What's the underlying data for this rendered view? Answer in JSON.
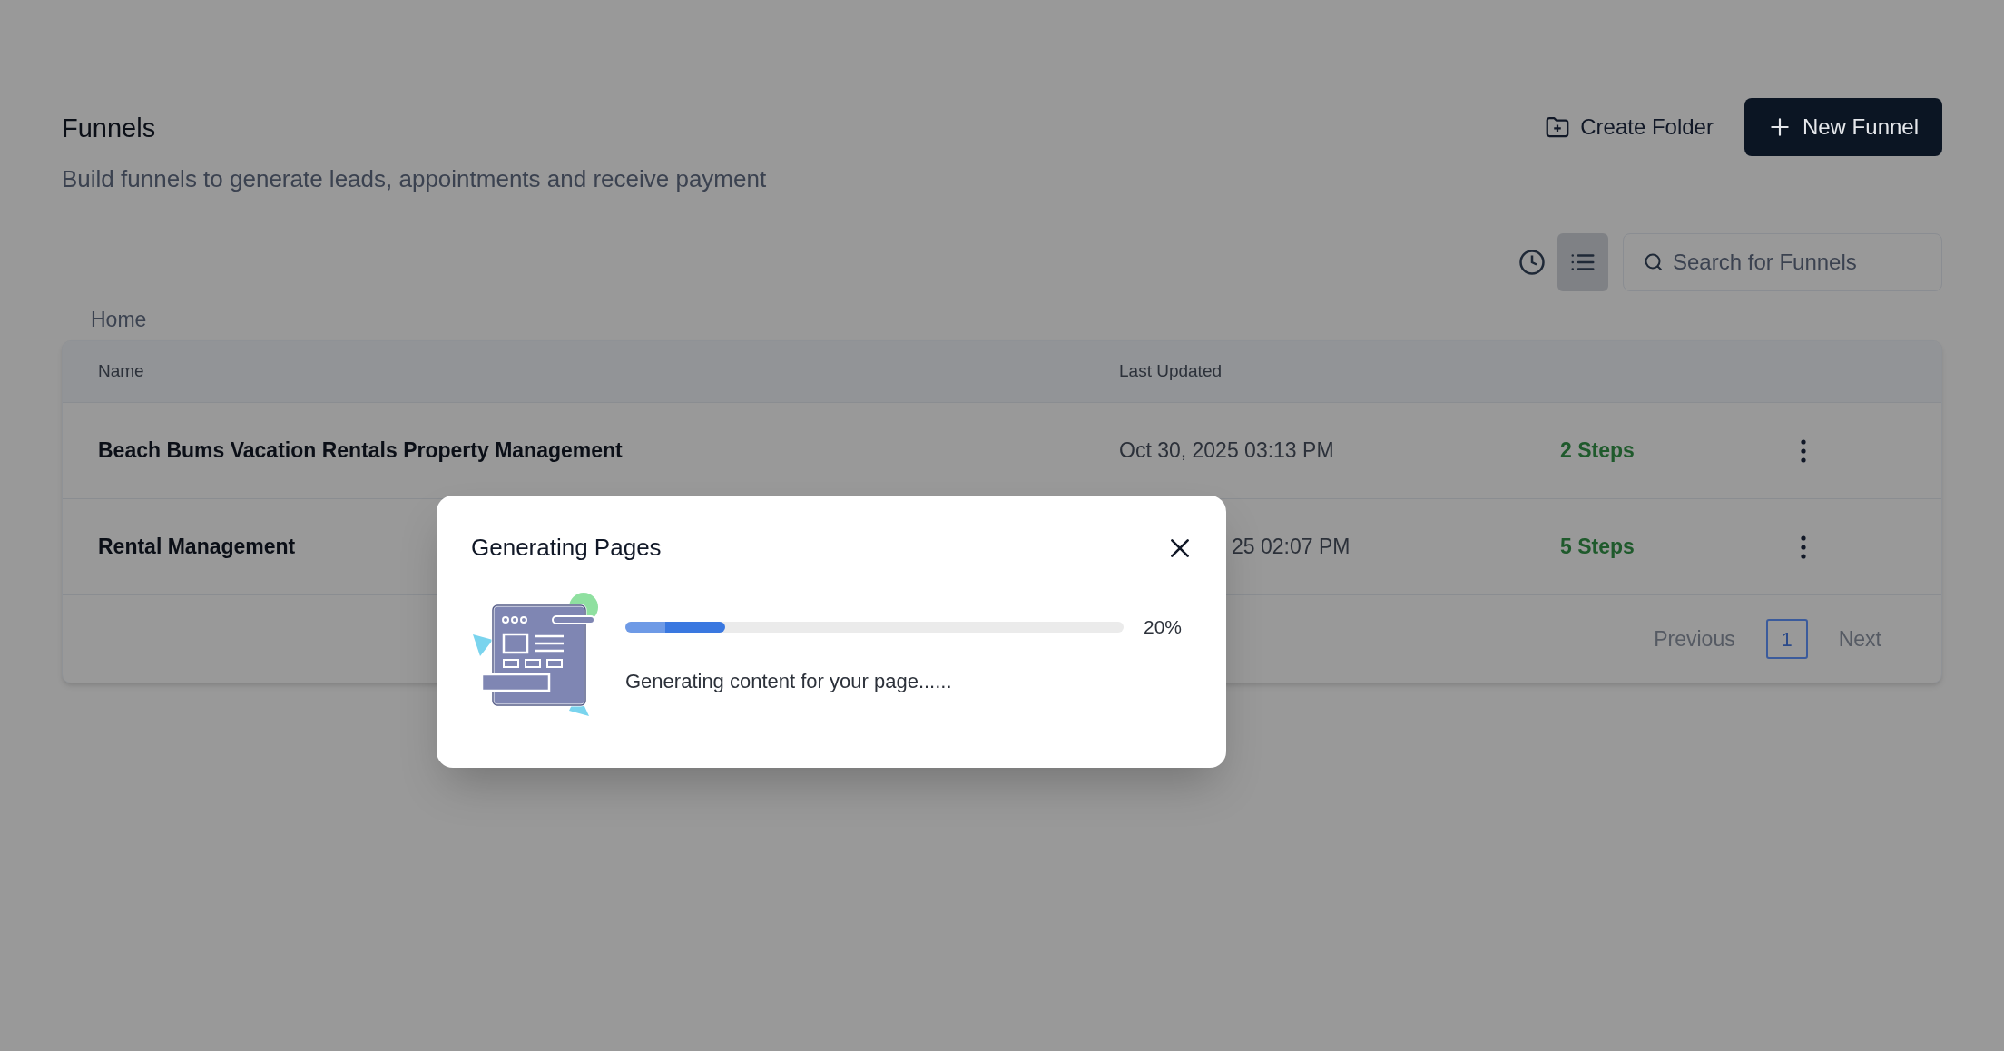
{
  "header": {
    "title": "Funnels",
    "subtitle": "Build funnels to generate leads, appointments and receive payment"
  },
  "actions": {
    "create_folder": "Create Folder",
    "new_funnel": "New Funnel"
  },
  "view_toggle": [
    {
      "kind": "recent",
      "selected": false
    },
    {
      "kind": "list",
      "selected": true
    }
  ],
  "search": {
    "placeholder": "Search for Funnels"
  },
  "breadcrumb": "Home",
  "table": {
    "columns": [
      "Name",
      "Last Updated"
    ],
    "rows": [
      {
        "name": "Beach Bums Vacation Rentals Property Management",
        "last_updated": "Oct 30, 2025 03:13 PM",
        "steps": "2 Steps"
      },
      {
        "name": "Rental Management",
        "last_updated": "25 02:07 PM",
        "steps": "5 Steps"
      }
    ]
  },
  "pagination": {
    "previous": "Previous",
    "pages": [
      {
        "label": "1",
        "selected": true
      }
    ],
    "next": "Next"
  },
  "dialog": {
    "title": "Generating Pages",
    "progress": {
      "level": 0.2,
      "reading": "20%"
    },
    "message": "Generating content for your page......"
  }
}
